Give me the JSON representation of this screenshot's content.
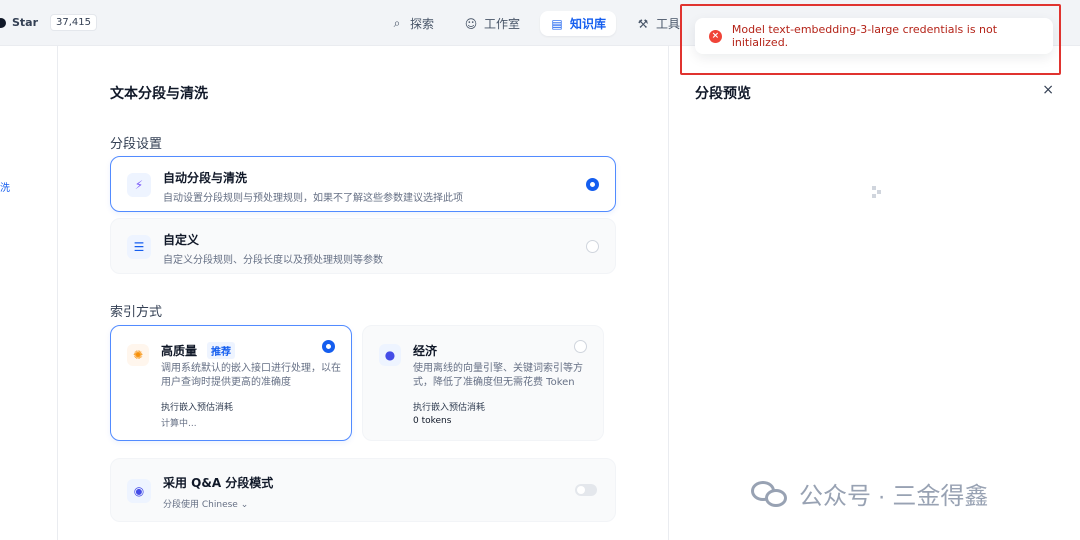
{
  "header": {
    "github": {
      "star_label": "Star",
      "star_count": "37,415"
    },
    "nav": [
      {
        "label": "探索",
        "icon": "compass-icon"
      },
      {
        "label": "工作室",
        "icon": "robot-icon"
      },
      {
        "label": "知识库",
        "icon": "book-icon",
        "active": true
      },
      {
        "label": "工具",
        "icon": "tool-icon"
      }
    ]
  },
  "sidebar": {
    "fragment_label": "洗"
  },
  "main": {
    "title": "文本分段与清洗",
    "segment_section_label": "分段设置",
    "segment_options": [
      {
        "title": "自动分段与清洗",
        "desc": "自动设置分段规则与预处理规则，如果不了解这些参数建议选择此项",
        "selected": true
      },
      {
        "title": "自定义",
        "desc": "自定义分段规则、分段长度以及预处理规则等参数",
        "selected": false
      }
    ],
    "index_section_label": "索引方式",
    "index_options": [
      {
        "title": "高质量",
        "badge": "推荐",
        "desc": "调用系统默认的嵌入接口进行处理，以在用户查询时提供更高的准确度",
        "cost_label": "执行嵌入预估消耗",
        "cost_value": "计算中...",
        "selected": true
      },
      {
        "title": "经济",
        "badge": "",
        "desc": "使用离线的向量引擎、关键词索引等方式，降低了准确度但无需花费 Token",
        "cost_label": "执行嵌入预估消耗",
        "cost_value": "0 tokens",
        "selected": false
      }
    ],
    "qa": {
      "title": "采用 Q&A 分段模式",
      "lang_prefix": "分段使用",
      "lang_value": "Chinese",
      "enabled": false
    }
  },
  "preview": {
    "title": "分段预览",
    "close_symbol": "×"
  },
  "toast": {
    "message": "Model text-embedding-3-large credentials is not initialized.",
    "type": "error"
  },
  "watermark": {
    "text": "公众号 · 三金得鑫"
  },
  "colors": {
    "accent": "#155eef",
    "error": "#f04438",
    "highlight_frame": "#e0332f"
  }
}
